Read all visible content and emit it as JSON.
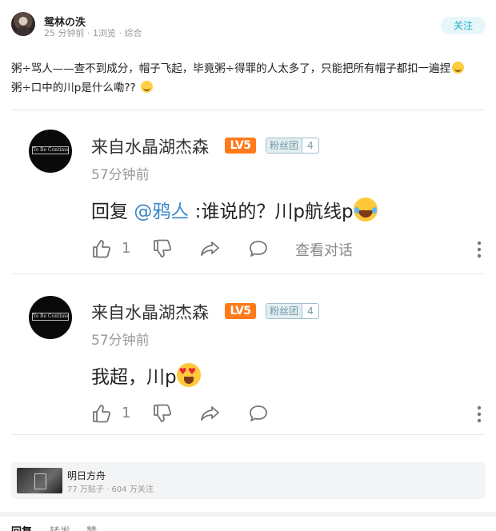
{
  "post": {
    "author": "鸳林の泆",
    "meta": "25 分钟前 · 1浏览 · 综合",
    "follow_label": "关注",
    "line1": "粥÷骂人——查不到成分，帽子飞起，毕竟粥÷得罪的人太多了，只能把所有帽子都扣一遍捏",
    "line2": "粥÷口中的川p是什么嘞??",
    "line1_emoji": "sweat-smile-emoji",
    "line2_emoji": "flushed-emoji"
  },
  "comments": [
    {
      "avatar_text": "To Be Continued",
      "name": "来自水晶湖杰森",
      "level": "LV5",
      "fan_label": "粉丝团",
      "fan_level": "4",
      "time": "57分钟前",
      "reply_prefix": "回复 ",
      "mention": "@鸦亼",
      "body": " :谁说的？川p航线p",
      "emoji": "tears-of-joy-emoji",
      "likes": "1",
      "view_conversation": "查看对话"
    },
    {
      "avatar_text": "To Be Continued",
      "name": "来自水晶湖杰森",
      "level": "LV5",
      "fan_label": "粉丝团",
      "fan_level": "4",
      "time": "57分钟前",
      "body": "我超，川p",
      "emoji": "heart-eyes-emoji",
      "likes": "1"
    }
  ],
  "forum": {
    "name": "明日方舟",
    "stats": "77 万贴子 · 604 万关注"
  },
  "bottom_tabs": [
    "回复",
    "转发",
    "赞"
  ],
  "colors": {
    "accent": "#1ab3c8",
    "level_badge": "#ff7a1a",
    "mention": "#3a86c8"
  }
}
